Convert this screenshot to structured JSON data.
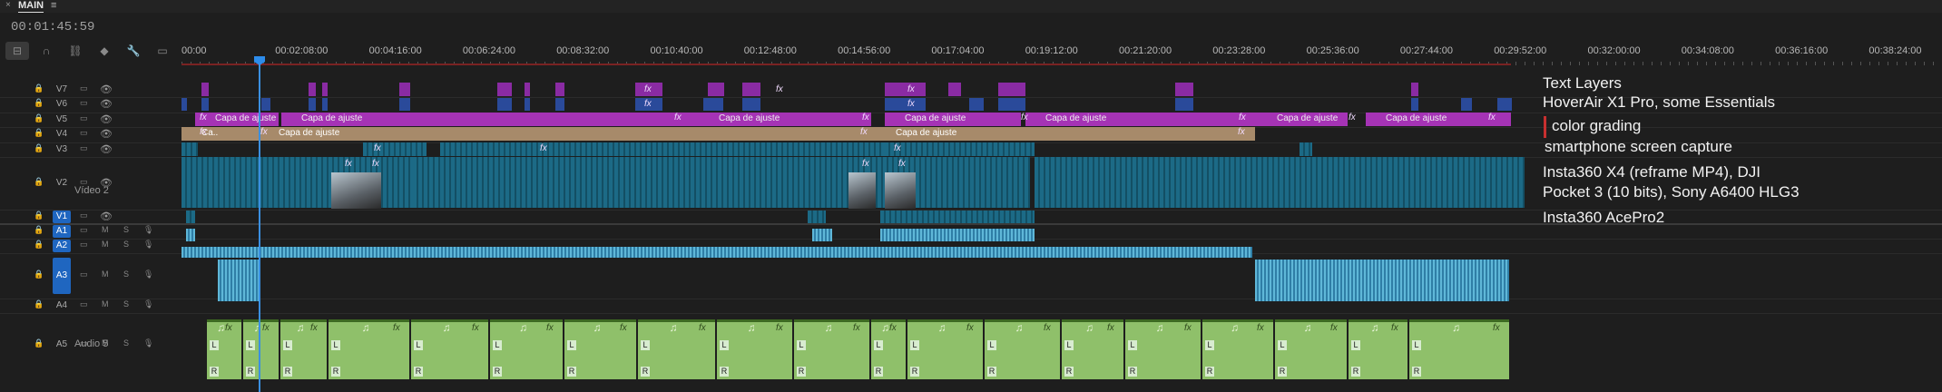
{
  "panel": {
    "close_glyph": "×",
    "tab": "MAIN",
    "menu_glyph": "≡"
  },
  "timecode": "00:01:45:59",
  "tools": [
    {
      "name": "insert-sequence-icon",
      "glyph": "⊟"
    },
    {
      "name": "snap-icon",
      "glyph": "∩"
    },
    {
      "name": "linked-selection-icon",
      "glyph": "⛓"
    },
    {
      "name": "add-marker-icon",
      "glyph": "◆"
    },
    {
      "name": "settings-wrench-icon",
      "glyph": "🔧"
    },
    {
      "name": "captions-icon",
      "glyph": "▭"
    }
  ],
  "ruler": [
    "00:00",
    "00:02:08:00",
    "00:04:16:00",
    "00:06:24:00",
    "00:08:32:00",
    "00:10:40:00",
    "00:12:48:00",
    "00:14:56:00",
    "00:17:04:00",
    "00:19:12:00",
    "00:21:20:00",
    "00:23:28:00",
    "00:25:36:00",
    "00:27:44:00",
    "00:29:52:00",
    "00:32:00:00",
    "00:34:08:00",
    "00:36:16:00",
    "00:38:24:00"
  ],
  "video_tracks": [
    "V7",
    "V6",
    "V5",
    "V4",
    "V3",
    "V2",
    "V1"
  ],
  "v2_name": "Vídeo 2",
  "audio_tracks": [
    "A1",
    "A2",
    "A3",
    "A4",
    "A5"
  ],
  "a5_name": "Audio 5",
  "mute_label": "M",
  "solo_label": "S",
  "fx_label": "fx",
  "note_glyph": "♫",
  "L_label": "L",
  "R_label": "R",
  "adjustment_clip": "Capa de ajuste",
  "adjustment_clip_short": "Ca...",
  "layer_notes": {
    "text_layers": "Text Layers",
    "hoverair": "HoverAir X1 Pro, some Essentials",
    "color": "color  grading",
    "smartphone": "smartphone screen capture",
    "insta_line1": "Insta360 X4 (reframe MP4), DJI",
    "insta_line2": "Pocket 3 (10 bits), Sony A6400 HLG3",
    "acepro": "Insta360 AcePro2"
  },
  "colors": {
    "adjust": "#a533b5",
    "adjust_v4": "#a78a6a",
    "video": "#1c6a86",
    "audio": "#5fb7d8",
    "music": "#8fc06a",
    "playhead": "#2d8ceb",
    "track_on": "#1f66c0"
  }
}
